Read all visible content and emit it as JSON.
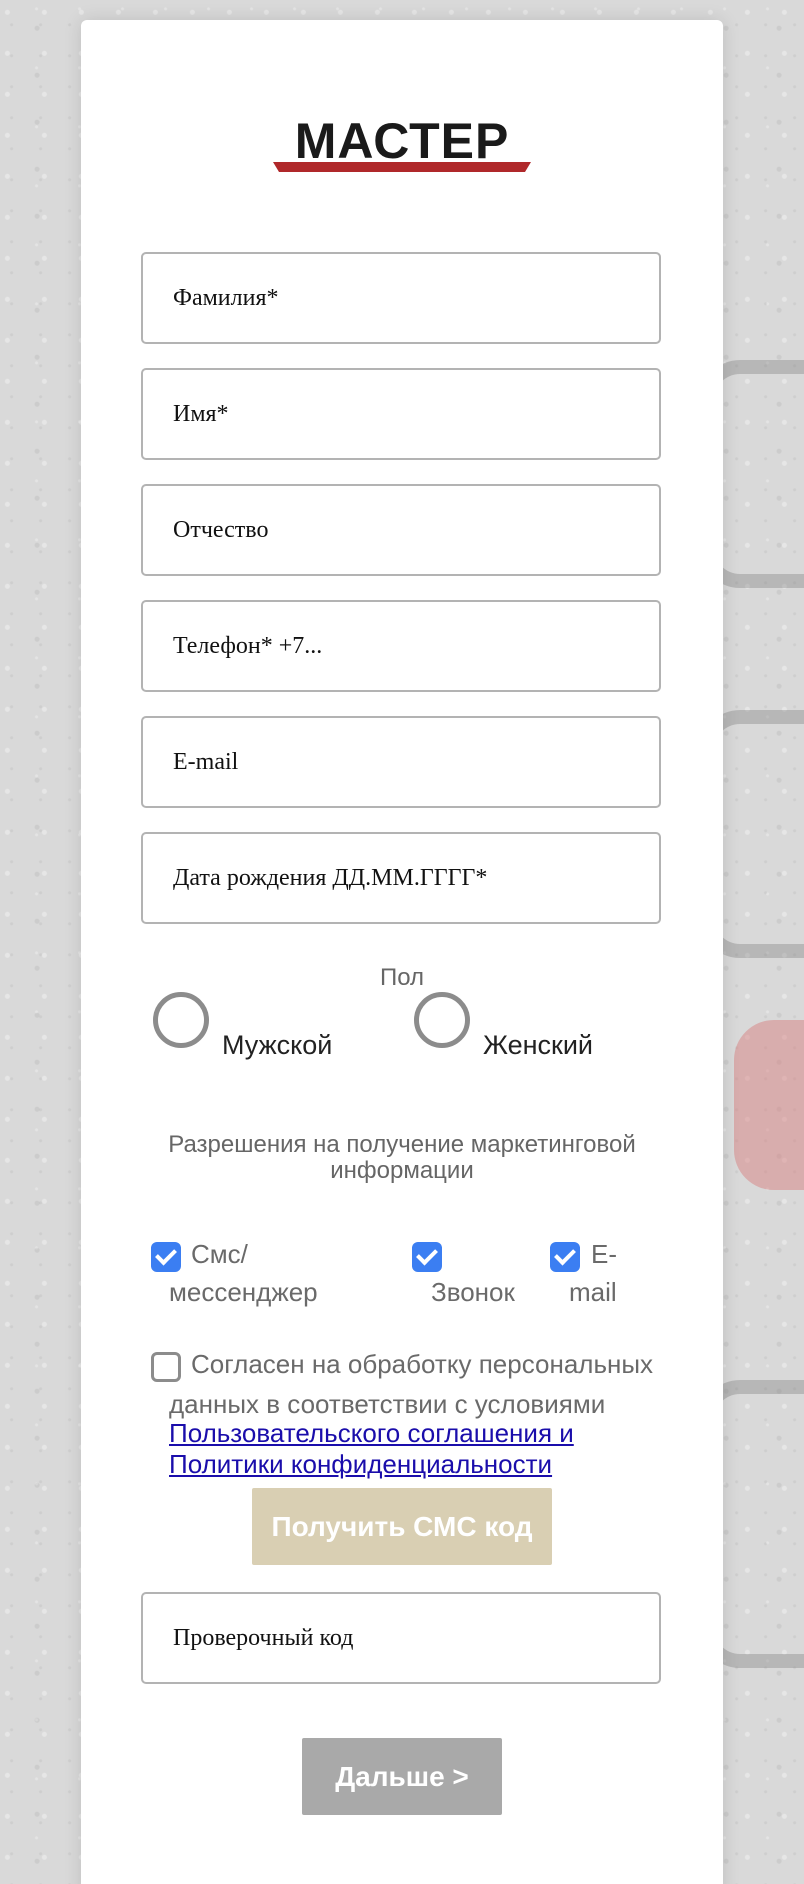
{
  "brand": {
    "logo_text": "МАСТЕР",
    "accent_color": "#b0282a",
    "logo_color": "#1a1a1a"
  },
  "form": {
    "last_name_placeholder": "Фамилия*",
    "first_name_placeholder": "Имя*",
    "patronymic_placeholder": "Отчество",
    "phone_placeholder": "Телефон* +7...",
    "email_placeholder": "E-mail",
    "birthdate_placeholder": "Дата рождения ДД.ММ.ГГГГ*",
    "verification_code_placeholder": "Проверочный код"
  },
  "gender": {
    "title": "Пол",
    "male_label": "Мужской",
    "female_label": "Женский",
    "selected": null
  },
  "permissions": {
    "heading": "Разрешения на получение маркетинговой информации",
    "sms_line1": "Смс/",
    "sms_line2": "мессенджер",
    "sms_checked": true,
    "call_label": "Звонок",
    "call_checked": true,
    "email_line1": "E-",
    "email_line2": "mail",
    "email_checked": true,
    "check_color": "#3b7ef2"
  },
  "consent": {
    "line1": "Согласен на обработку персональных",
    "line2": "данных в соответствии с условиями",
    "link_text": "Пользовательского соглашения и Политики конфиденциальности",
    "checked": false
  },
  "buttons": {
    "get_sms_code": "Получить СМС код",
    "get_sms_code_color": "#d9cfb3",
    "next": "Дальше >",
    "next_color": "#a9a9a9"
  }
}
